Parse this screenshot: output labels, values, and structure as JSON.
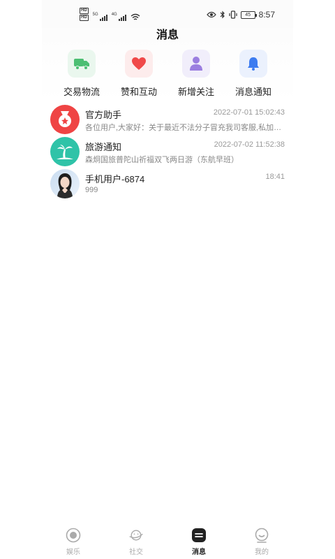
{
  "status_bar": {
    "hd1": "HD",
    "hd2": "HD",
    "net1": "5G",
    "net2": "4G",
    "battery": "45",
    "time": "8:57"
  },
  "page_title": "消息",
  "categories": [
    {
      "label": "交易物流",
      "icon": "truck-icon",
      "color": "#4cbf73",
      "bg": "#eaf7ee"
    },
    {
      "label": "赞和互动",
      "icon": "heart-icon",
      "color": "#f04848",
      "bg": "#fdecec"
    },
    {
      "label": "新增关注",
      "icon": "person-icon",
      "color": "#9b7ee0",
      "bg": "#f1eefb"
    },
    {
      "label": "消息通知",
      "icon": "bell-icon",
      "color": "#3d7cf0",
      "bg": "#ebf1fd"
    }
  ],
  "conversations": [
    {
      "name": "官方助手",
      "time": "2022-07-01 15:02:43",
      "preview": "各位用户,大家好：关于最近不法分子冒充我司客服,私加各位用户进行诈骗",
      "avatar": "medal-icon",
      "color": "#ef4444"
    },
    {
      "name": "旅游通知",
      "time": "2022-07-02 11:52:38",
      "preview": "森炯国旅普陀山祈福双飞两日游（东航早班）",
      "avatar": "palm-tree-icon",
      "color": "#2fc3a8"
    },
    {
      "name": "手机用户-6874",
      "time": "18:41",
      "preview": "999",
      "avatar": "user-photo",
      "color": "#9ab6d8"
    }
  ],
  "tabs": [
    {
      "label": "娱乐",
      "icon": "target-icon",
      "active": false
    },
    {
      "label": "社交",
      "icon": "planet-icon",
      "active": false
    },
    {
      "label": "消息",
      "icon": "message-icon",
      "active": true
    },
    {
      "label": "我的",
      "icon": "smile-icon",
      "active": false
    }
  ]
}
